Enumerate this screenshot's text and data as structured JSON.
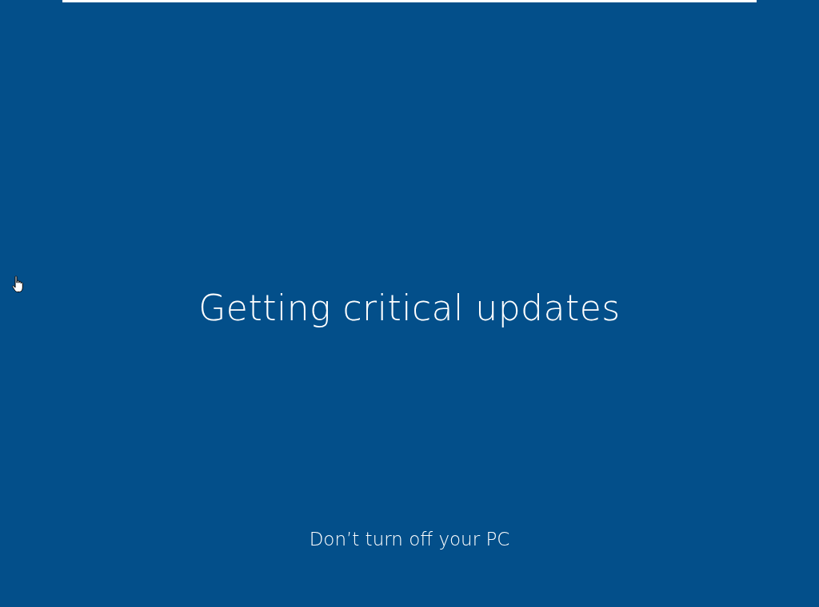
{
  "title": "Getting critical updates",
  "notice": "Don’t turn off your PC"
}
